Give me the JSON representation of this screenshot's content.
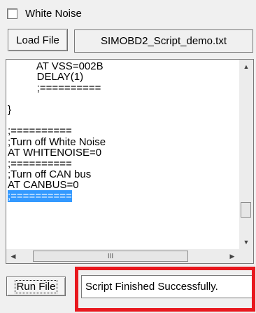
{
  "white_noise": {
    "label": "White Noise",
    "checked": false
  },
  "load_file": {
    "button_label": "Load File",
    "file_name": "SIMOBD2_Script_demo.txt"
  },
  "script": {
    "lines": [
      {
        "text": "          AT VSS=002B",
        "selected": false
      },
      {
        "text": "          DELAY(1)",
        "selected": false
      },
      {
        "text": "          ;==========",
        "selected": false
      },
      {
        "text": "",
        "selected": false
      },
      {
        "text": "}",
        "selected": false
      },
      {
        "text": "",
        "selected": false
      },
      {
        "text": ";==========",
        "selected": false
      },
      {
        "text": ";Turn off White Noise",
        "selected": false
      },
      {
        "text": "AT WHITENOISE=0",
        "selected": false
      },
      {
        "text": ";==========",
        "selected": false
      },
      {
        "text": ";Turn off CAN bus",
        "selected": false
      },
      {
        "text": "AT CANBUS=0",
        "selected": false
      },
      {
        "text": ";==========",
        "selected": true
      }
    ],
    "hscroll_grip": "III",
    "icons": {
      "up": "arrow-up-icon",
      "down": "arrow-down-icon",
      "left": "arrow-left-icon",
      "right": "arrow-right-icon"
    }
  },
  "run_file": {
    "button_label": "Run File"
  },
  "status": {
    "message": "Script Finished Successfully."
  },
  "colors": {
    "highlight": "#e8181e",
    "selection": "#3399ff"
  }
}
